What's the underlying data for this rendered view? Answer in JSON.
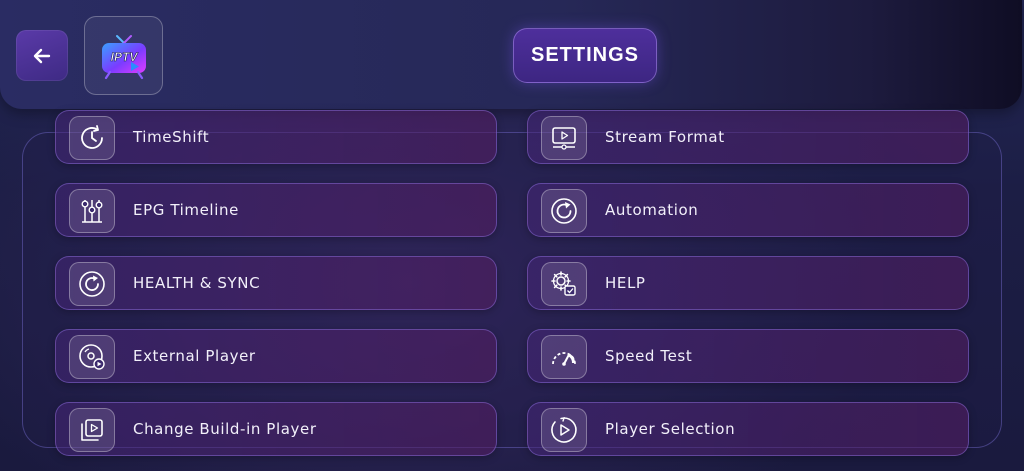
{
  "header": {
    "back_icon": "arrow-left-icon",
    "logo_text": "IPTV",
    "title": "SETTINGS"
  },
  "colors": {
    "accent": "#4e2f9c",
    "background": "#1c1e45",
    "item_gradient_start": "#46267a",
    "item_gradient_end": "#521e62"
  },
  "settings": {
    "left": [
      {
        "label": "TimeShift",
        "icon": "clock-history-icon"
      },
      {
        "label": "EPG Timeline",
        "icon": "timeline-sliders-icon"
      },
      {
        "label": "HEALTH & SYNC",
        "icon": "sync-refresh-icon"
      },
      {
        "label": "External Player",
        "icon": "disc-player-icon"
      },
      {
        "label": "Change Build-in Player",
        "icon": "play-stack-icon"
      }
    ],
    "right": [
      {
        "label": "Stream Format",
        "icon": "monitor-play-icon"
      },
      {
        "label": "Automation",
        "icon": "refresh-cycle-icon"
      },
      {
        "label": "HELP",
        "icon": "gear-help-icon"
      },
      {
        "label": "Speed Test",
        "icon": "speedometer-icon"
      },
      {
        "label": "Player Selection",
        "icon": "play-circle-icon"
      }
    ]
  }
}
